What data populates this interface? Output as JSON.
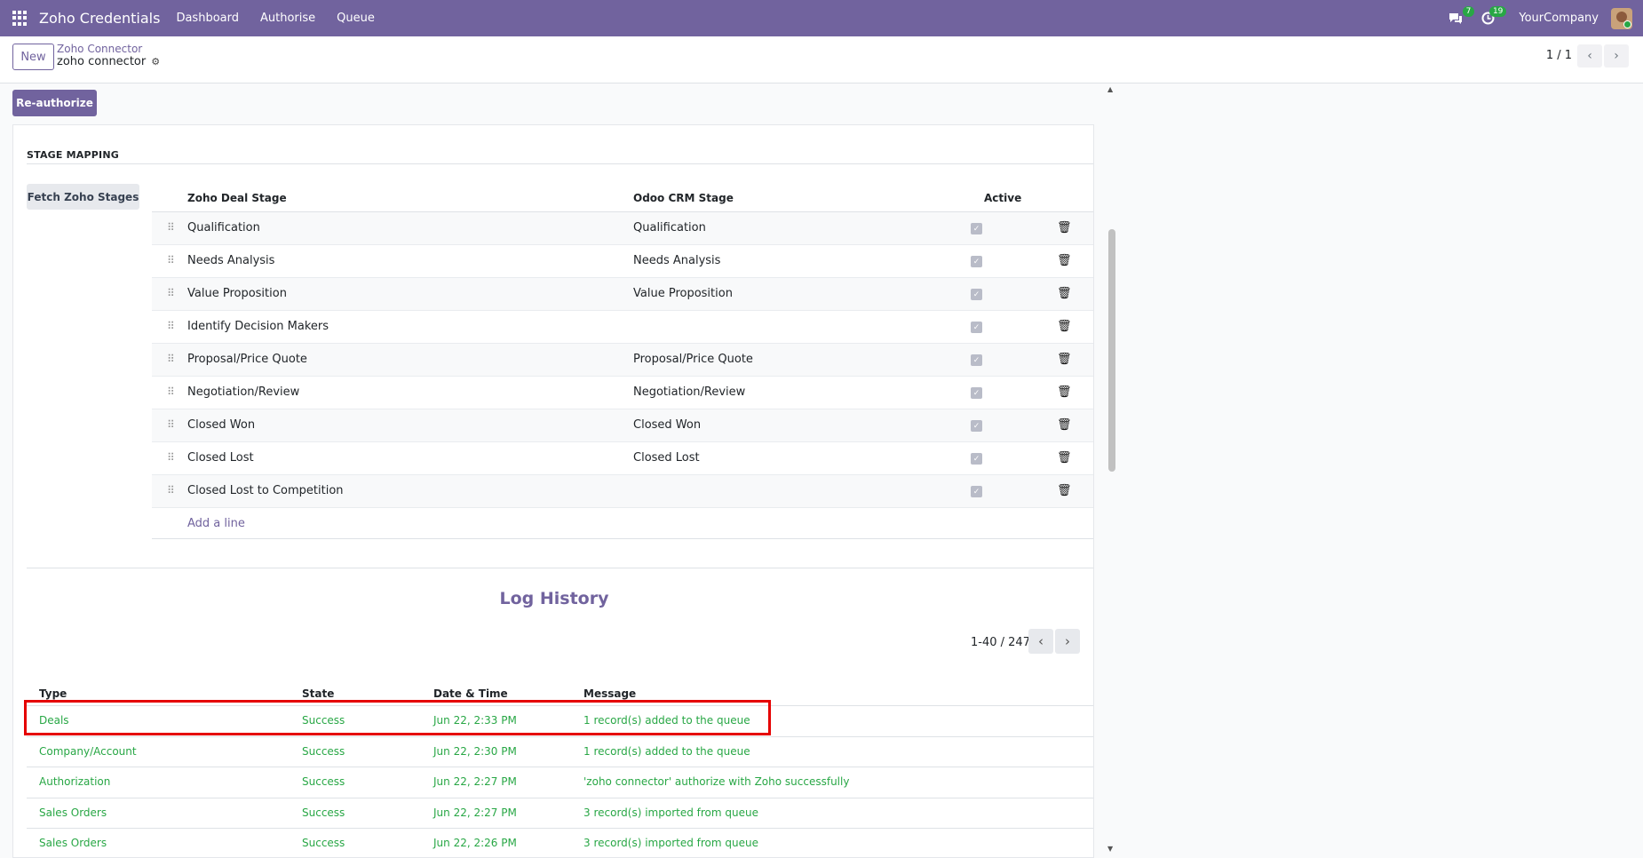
{
  "navbar": {
    "app_title": "Zoho Credentials",
    "menu": [
      "Dashboard",
      "Authorise",
      "Queue"
    ],
    "messages_count": "7",
    "activities_count": "19",
    "company": "YourCompany",
    "color": "#71639e"
  },
  "control": {
    "new_label": "New",
    "breadcrumb_parent": "Zoho Connector",
    "breadcrumb_current": "zoho connector",
    "pager": "1 / 1"
  },
  "statusbar": {
    "reauthorize_label": "Re-authorize"
  },
  "stage_mapping": {
    "title": "STAGE MAPPING",
    "fetch_label": "Fetch Zoho Stages",
    "columns": [
      "Zoho Deal Stage",
      "Odoo CRM Stage",
      "Active"
    ],
    "rows": [
      {
        "zoho": "Qualification",
        "odoo": "Qualification",
        "active": true
      },
      {
        "zoho": "Needs Analysis",
        "odoo": "Needs Analysis",
        "active": true
      },
      {
        "zoho": "Value Proposition",
        "odoo": "Value Proposition",
        "active": true
      },
      {
        "zoho": "Identify Decision Makers",
        "odoo": "",
        "active": true
      },
      {
        "zoho": "Proposal/Price Quote",
        "odoo": "Proposal/Price Quote",
        "active": true
      },
      {
        "zoho": "Negotiation/Review",
        "odoo": "Negotiation/Review",
        "active": true
      },
      {
        "zoho": "Closed Won",
        "odoo": "Closed Won",
        "active": true
      },
      {
        "zoho": "Closed Lost",
        "odoo": "Closed Lost",
        "active": true
      },
      {
        "zoho": "Closed Lost to Competition",
        "odoo": "",
        "active": true
      }
    ],
    "add_line_label": "Add a line"
  },
  "log_history": {
    "title": "Log History",
    "pager": "1-40 / 247",
    "columns": [
      "Type",
      "State",
      "Date & Time",
      "Message"
    ],
    "rows": [
      {
        "type": "Deals",
        "state": "Success",
        "date": "Jun 22, 2:33 PM",
        "message": "1 record(s) added to the queue"
      },
      {
        "type": "Company/Account",
        "state": "Success",
        "date": "Jun 22, 2:30 PM",
        "message": "1 record(s) added to the queue"
      },
      {
        "type": "Authorization",
        "state": "Success",
        "date": "Jun 22, 2:27 PM",
        "message": "'zoho connector' authorize with Zoho successfully"
      },
      {
        "type": "Sales Orders",
        "state": "Success",
        "date": "Jun 22, 2:27 PM",
        "message": "3 record(s) imported from queue"
      },
      {
        "type": "Sales Orders",
        "state": "Success",
        "date": "Jun 22, 2:26 PM",
        "message": "3 record(s) imported from queue"
      }
    ],
    "success_color": "#28a745"
  }
}
